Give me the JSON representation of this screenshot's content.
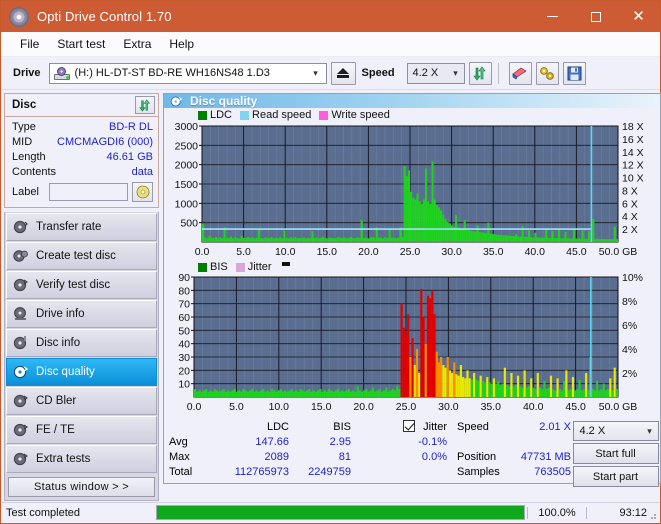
{
  "window": {
    "title": "Opti Drive Control 1.70",
    "icon": "disc-icon",
    "controls": {
      "minimize": "minimize-icon",
      "maximize": "maximize-icon",
      "close": "close-icon"
    }
  },
  "menu": {
    "items": [
      "File",
      "Start test",
      "Extra",
      "Help"
    ]
  },
  "toolbar": {
    "drive_label": "Drive",
    "drive_value": "(H:) HL-DT-ST BD-RE  WH16NS48 1.D3",
    "eject_icon": "eject-icon",
    "speed_label": "Speed",
    "speed_value": "4.2 X",
    "refresh_icon": "refresh-icon",
    "eraser_icon": "eraser-icon",
    "tools_icon": "tools-icon",
    "save_icon": "save-icon"
  },
  "disc_panel": {
    "title": "Disc",
    "refresh_icon": "refresh-icon",
    "rows": [
      {
        "key": "Type",
        "value": "BD-R DL"
      },
      {
        "key": "MID",
        "value": "CMCMAGDI6 (000)"
      },
      {
        "key": "Length",
        "value": "46.61 GB"
      },
      {
        "key": "Contents",
        "value": "data"
      }
    ],
    "label_key": "Label",
    "label_value": "",
    "label_button_icon": "disc-icon"
  },
  "sidebar": {
    "items": [
      {
        "label": "Transfer rate",
        "active": false
      },
      {
        "label": "Create test disc",
        "active": false
      },
      {
        "label": "Verify test disc",
        "active": false
      },
      {
        "label": "Drive info",
        "active": false
      },
      {
        "label": "Disc info",
        "active": false
      },
      {
        "label": "Disc quality",
        "active": true
      },
      {
        "label": "CD Bler",
        "active": false
      },
      {
        "label": "FE / TE",
        "active": false
      },
      {
        "label": "Extra tests",
        "active": false
      }
    ],
    "status_window_button": "Status window > >"
  },
  "main": {
    "title": "Disc quality",
    "title_icon": "disc-quality-icon"
  },
  "stats": {
    "col_headers": [
      "LDC",
      "BIS"
    ],
    "row_labels": [
      "Avg",
      "Max",
      "Total"
    ],
    "ldc": {
      "avg": "147.66",
      "max": "2089",
      "total": "112765973"
    },
    "bis": {
      "avg": "2.95",
      "max": "81",
      "total": "2249759"
    },
    "jitter": {
      "label": "Jitter",
      "checked": true,
      "avg": "-0.1%",
      "max": "0.0%"
    },
    "speed_label": "Speed",
    "speed_value": "2.01 X",
    "position_label": "Position",
    "position_value": "47731 MB",
    "samples_label": "Samples",
    "samples_value": "763505",
    "speed_select": "4.2 X",
    "start_full": "Start full",
    "start_part": "Start part"
  },
  "statusbar": {
    "text": "Test completed",
    "percent": "100.0%",
    "progress": 100,
    "time": "93:12"
  },
  "colors": {
    "titlebar": "#cd5c35",
    "accent_blue": "#2222cc",
    "plot_bg": "#5a6e91",
    "ldc_green": "#1fd21f",
    "read_speed": "#7fd4f2",
    "write_speed": "#ff5ce0",
    "bis_green": "#1fd21f",
    "jitter_pink": "#d9a8d9",
    "progress_green": "#0fa81c",
    "active_nav": "#0a8fd8"
  },
  "chart_data": [
    {
      "type": "area",
      "title": "LDC / Read speed / Write speed",
      "legend": [
        {
          "name": "LDC",
          "color": "#008000"
        },
        {
          "name": "Read speed",
          "color": "#7fd4f2"
        },
        {
          "name": "Write speed",
          "color": "#ff5ce0"
        }
      ],
      "legend_position": "top-left",
      "xlabel": "GB",
      "xlim": [
        0,
        50
      ],
      "xticks": [
        "0.0",
        "5.0",
        "10.0",
        "15.0",
        "20.0",
        "25.0",
        "30.0",
        "35.0",
        "40.0",
        "45.0",
        "50.0 GB"
      ],
      "ylabel": "LDC",
      "ylim": [
        0,
        3000
      ],
      "yticks": [
        500,
        1000,
        1500,
        2000,
        2500,
        3000
      ],
      "y2label": "Speed",
      "y2lim": [
        0,
        18
      ],
      "y2ticks": [
        "2 X",
        "4 X",
        "6 X",
        "8 X",
        "10 X",
        "12 X",
        "14 X",
        "16 X",
        "18 X"
      ],
      "grid": true,
      "read_speed_line": 2.01,
      "scan_end_gb": 46.8,
      "series": [
        {
          "name": "LDC",
          "color": "#1fd21f",
          "x_step_gb": 0.25,
          "values": [
            480,
            120,
            95,
            150,
            110,
            100,
            130,
            90,
            120,
            95,
            380,
            110,
            100,
            140,
            95,
            120,
            100,
            90,
            160,
            110,
            95,
            130,
            100,
            120,
            90,
            110,
            340,
            100,
            95,
            120,
            110,
            100,
            130,
            95,
            110,
            100,
            120,
            90,
            300,
            110,
            95,
            120,
            100,
            130,
            95,
            110,
            100,
            120,
            90,
            110,
            95,
            280,
            100,
            120,
            95,
            110,
            130,
            100,
            95,
            120,
            110,
            100,
            95,
            130,
            110,
            100,
            120,
            95,
            110,
            130,
            100,
            95,
            120,
            110,
            560,
            100,
            120,
            95,
            110,
            130,
            100,
            380,
            120,
            110,
            95,
            130,
            100,
            350,
            110,
            120,
            95,
            110,
            380,
            130,
            1960,
            1700,
            1850,
            1300,
            1150,
            1100,
            1250,
            1050,
            1000,
            1100,
            1900,
            1050,
            1000,
            2089,
            1100,
            950,
            900,
            820,
            700,
            600,
            520,
            480,
            430,
            400,
            700,
            380,
            350,
            330,
            560,
            320,
            300,
            290,
            280,
            270,
            430,
            260,
            250,
            240,
            230,
            500,
            220,
            210,
            200,
            190,
            185,
            180,
            175,
            170,
            165,
            160,
            155,
            150,
            200,
            145,
            140,
            420,
            135,
            130,
            300,
            125,
            120,
            240,
            118,
            115,
            112,
            110,
            350,
            108,
            105,
            280,
            103,
            100,
            330,
            98,
            96,
            260,
            95,
            94,
            92,
            320,
            90,
            88,
            86,
            300,
            85,
            84,
            280,
            83,
            600,
            82,
            81,
            80,
            79,
            78,
            77,
            76,
            75,
            74,
            400,
            73
          ]
        }
      ]
    },
    {
      "type": "area",
      "title": "BIS / Jitter",
      "legend": [
        {
          "name": "BIS",
          "color": "#008000"
        },
        {
          "name": "Jitter",
          "color": "#d9a8d9"
        }
      ],
      "legend_position": "top-left",
      "xlabel": "GB",
      "xlim": [
        0,
        50
      ],
      "xticks": [
        "0.0",
        "5.0",
        "10.0",
        "15.0",
        "20.0",
        "25.0",
        "30.0",
        "35.0",
        "40.0",
        "45.0",
        "50.0 GB"
      ],
      "ylabel": "BIS",
      "ylim": [
        0,
        90
      ],
      "yticks": [
        10,
        20,
        30,
        40,
        50,
        60,
        70,
        80,
        90
      ],
      "y2label": "Jitter",
      "y2lim": [
        0,
        10
      ],
      "y2ticks": [
        "2%",
        "4%",
        "6%",
        "8%",
        "10%"
      ],
      "grid": true,
      "scan_end_gb": 46.8,
      "series": [
        {
          "name": "BIS",
          "x_step_gb": 0.25,
          "color_scale": {
            "low": "#1fd21f",
            "mid": "#e8e800",
            "high": "#ff8c00",
            "max": "#e00000"
          },
          "values": [
            6,
            4,
            5,
            4,
            5,
            6,
            4,
            5,
            4,
            6,
            5,
            4,
            5,
            6,
            4,
            5,
            4,
            5,
            6,
            4,
            5,
            4,
            6,
            5,
            4,
            5,
            6,
            4,
            5,
            4,
            5,
            6,
            4,
            5,
            4,
            6,
            5,
            4,
            5,
            6,
            4,
            5,
            4,
            5,
            6,
            4,
            5,
            4,
            6,
            5,
            4,
            5,
            6,
            4,
            5,
            4,
            5,
            6,
            4,
            5,
            4,
            6,
            5,
            4,
            5,
            6,
            4,
            5,
            4,
            5,
            6,
            4,
            5,
            4,
            8,
            5,
            4,
            5,
            6,
            4,
            5,
            7,
            4,
            5,
            6,
            4,
            5,
            7,
            4,
            5,
            6,
            5,
            8,
            6,
            70,
            52,
            48,
            62,
            30,
            44,
            24,
            36,
            18,
            81,
            60,
            40,
            76,
            74,
            80,
            62,
            34,
            26,
            30,
            24,
            22,
            30,
            20,
            18,
            26,
            17,
            16,
            24,
            15,
            14,
            20,
            14,
            13,
            18,
            13,
            12,
            16,
            12,
            11,
            15,
            11,
            10,
            14,
            10,
            12,
            9,
            10,
            22,
            9,
            8,
            18,
            8,
            9,
            16,
            8,
            7,
            20,
            7,
            8,
            14,
            7,
            6,
            18,
            7,
            6,
            12,
            6,
            7,
            16,
            6,
            5,
            14,
            6,
            5,
            12,
            20,
            5,
            6,
            15,
            5,
            6,
            13,
            5,
            6,
            18,
            5,
            30,
            6,
            5,
            12,
            5,
            6,
            10,
            5,
            6,
            14,
            5,
            22,
            6
          ]
        }
      ]
    }
  ]
}
